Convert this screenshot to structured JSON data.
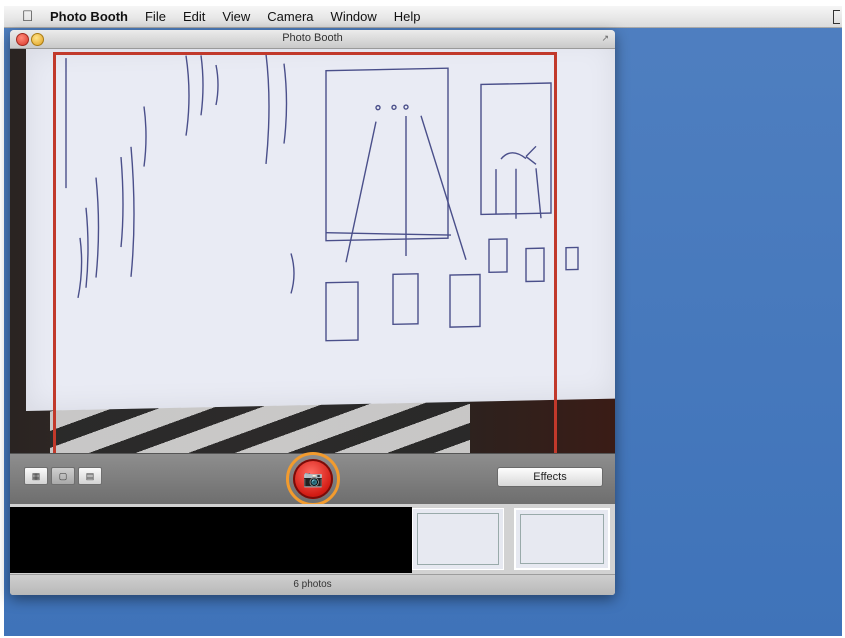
{
  "menubar": {
    "apple_icon": "apple-icon",
    "app_name": "Photo Booth",
    "items": [
      "File",
      "Edit",
      "View",
      "Camera",
      "Window",
      "Help"
    ]
  },
  "window": {
    "title": "Photo Booth"
  },
  "toolbar": {
    "view_modes": [
      "grid-view-icon",
      "single-view-icon",
      "filmstrip-view-icon"
    ],
    "active_view_mode": "single-view-icon",
    "shutter_icon": "camera-icon",
    "effects_label": "Effects"
  },
  "strip": {
    "thumbnail_count_visible": 2
  },
  "status": {
    "text": "6 photos"
  },
  "colors": {
    "highlight_frame": "#c1392b",
    "highlight_ring": "#f29b2e",
    "shutter_red": "#d31c14",
    "desktop_blue": "#3f73b9"
  }
}
